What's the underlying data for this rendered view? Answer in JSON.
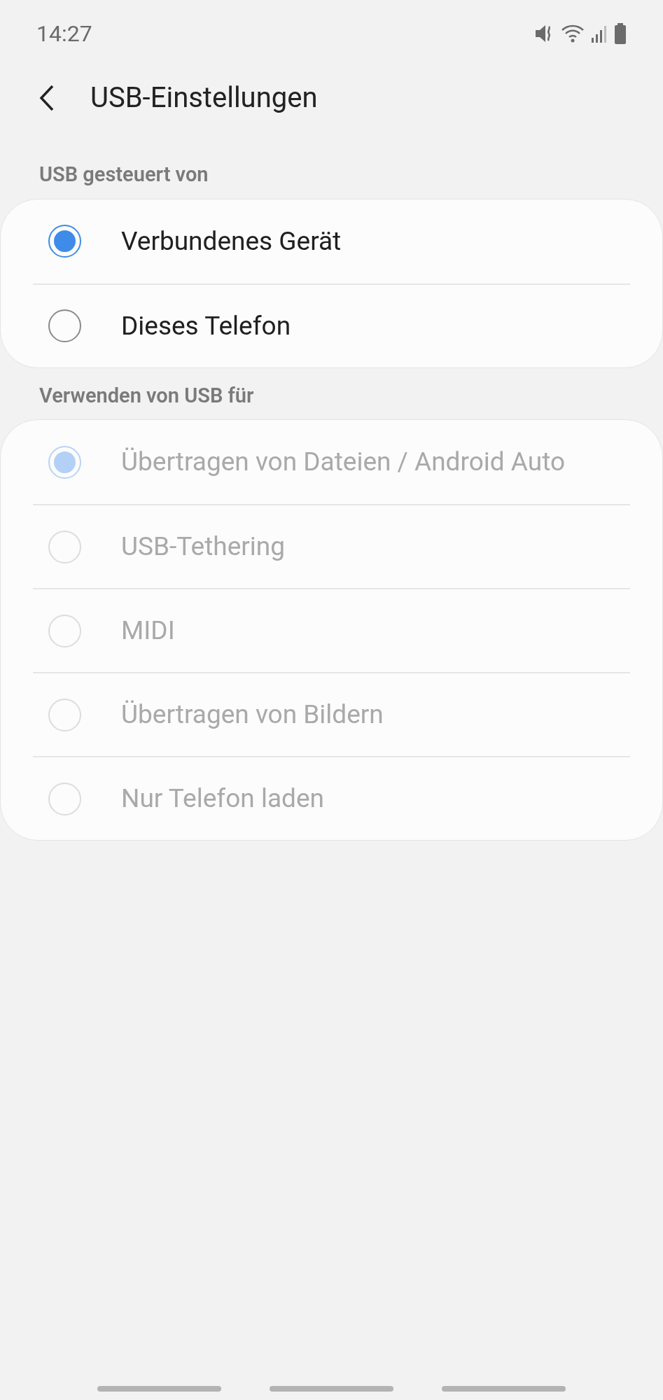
{
  "status_bar": {
    "time": "14:27"
  },
  "header": {
    "title": "USB-Einstellungen"
  },
  "sections": [
    {
      "title": "USB gesteuert von",
      "items": [
        {
          "label": "Verbundenes Gerät",
          "selected": true,
          "disabled": false
        },
        {
          "label": "Dieses Telefon",
          "selected": false,
          "disabled": false
        }
      ]
    },
    {
      "title": "Verwenden von USB für",
      "items": [
        {
          "label": "Übertragen von Dateien / Android Auto",
          "selected": true,
          "disabled": true
        },
        {
          "label": "USB-Tethering",
          "selected": false,
          "disabled": true
        },
        {
          "label": "MIDI",
          "selected": false,
          "disabled": true
        },
        {
          "label": "Übertragen von Bildern",
          "selected": false,
          "disabled": true
        },
        {
          "label": "Nur Telefon laden",
          "selected": false,
          "disabled": true
        }
      ]
    }
  ]
}
